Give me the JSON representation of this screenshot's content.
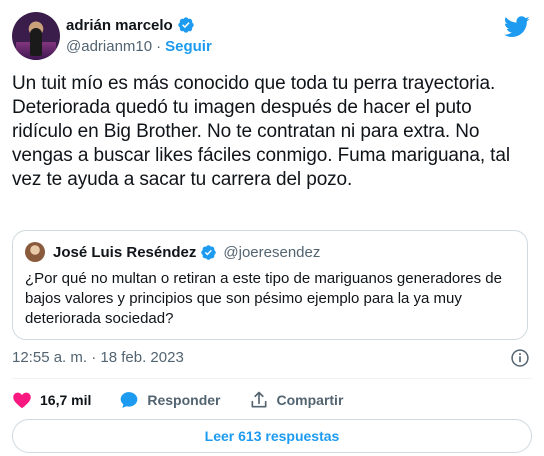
{
  "author": {
    "display_name": "adrián marcelo",
    "handle": "@adrianm10",
    "separator": "·",
    "follow_label": "Seguir"
  },
  "tweet": {
    "text": "Un tuit mío es más conocido que toda tu perra trayectoria. Deteriorada quedó tu imagen después de hacer el puto ridículo en Big Brother. No te contratan ni para extra. No vengas a buscar likes fáciles conmigo. Fuma mariguana, tal vez te ayuda a sacar tu carrera del pozo."
  },
  "quoted": {
    "display_name": "José Luis Reséndez",
    "handle": "@joeresendez",
    "text": "¿Por qué no multan o retiran a este tipo de mariguanos generadores de bajos valores y principios que son pésimo ejemplo para la ya muy deteriorada sociedad?"
  },
  "meta": {
    "timestamp": "12:55 a. m. · 18 feb. 2023"
  },
  "actions": {
    "likes": "16,7 mil",
    "reply_label": "Responder",
    "share_label": "Compartir"
  },
  "read_replies_label": "Leer 613 respuestas",
  "colors": {
    "accent": "#1d9bf0",
    "like": "#f91880",
    "muted": "#536471"
  },
  "icons": [
    "verified-icon",
    "twitter-bird-icon",
    "info-icon",
    "heart-icon",
    "reply-bubble-icon",
    "share-icon"
  ]
}
